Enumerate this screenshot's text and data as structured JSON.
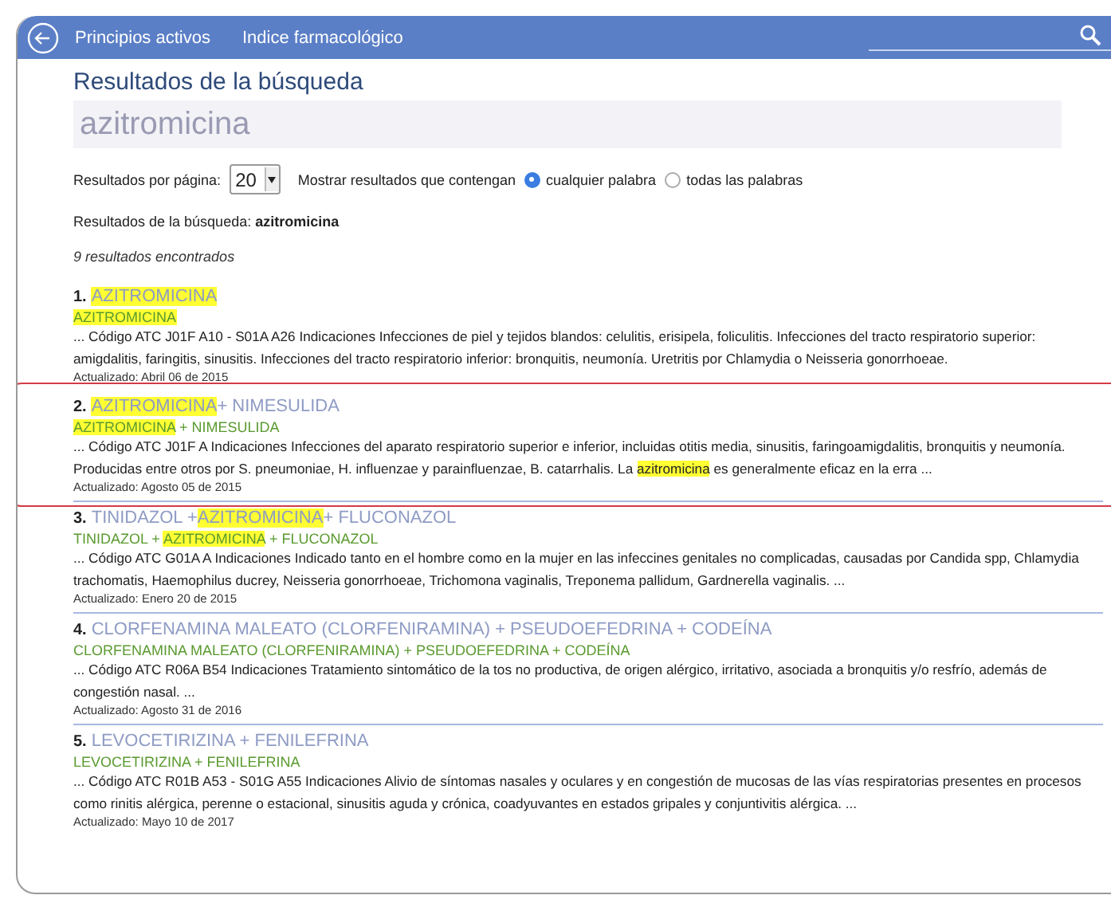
{
  "nav": {
    "links": [
      "Principios activos",
      "Indice farmacológico"
    ]
  },
  "heading": "Resultados de la búsqueda",
  "search": {
    "value": "azitromicina"
  },
  "options": {
    "per_page_label": "Resultados por página:",
    "per_page": "20",
    "contain_label": "Mostrar resultados que contengan",
    "radios": [
      {
        "label": "cualquier palabra",
        "selected": true
      },
      {
        "label": "todas las palabras",
        "selected": false
      }
    ]
  },
  "summary": "Resultados de la búsqueda: **azitromicina**",
  "count": "9 resultados encontrados",
  "results": [
    {
      "number": "1.",
      "circled": false,
      "title": [
        {
          "text": "AZITROMICINA",
          "highlight": true
        }
      ],
      "subtitle": [
        {
          "text": "AZITROMICINA",
          "highlight": true
        }
      ],
      "body": [
        {
          "text": "... Código ATC J01F A10 - S01A A26 Indicaciones Infecciones de piel y tejidos blandos: celulitis, erisipela, foliculitis. Infecciones del tracto respiratorio superior: amigdalitis, faringitis, sinusitis. Infecciones del tracto respiratorio inferior: bronquitis, neumonía. Uretritis por Chlamydia o Neisseria gonorrhoeae.",
          "highlight": false
        }
      ],
      "updated": "Actualizado: Abril 06 de 2015"
    },
    {
      "number": "2.",
      "circled": true,
      "title": [
        {
          "text": "AZITROMICINA",
          "highlight": true
        },
        {
          "text": " + NIMESULIDA",
          "highlight": false
        }
      ],
      "subtitle": [
        {
          "text": "AZITROMICINA",
          "highlight": true
        },
        {
          "text": " + NIMESULIDA",
          "highlight": false
        }
      ],
      "body": [
        {
          "text": "... Código ATC J01F A Indicaciones Infecciones del aparato respiratorio superior e inferior, incluidas otitis media, sinusitis, faringoamigdalitis, bronquitis y neumonía. Producidas entre otros por S. pneumoniae, H. influenzae y parainfluenzae, B. catarrhalis. La ",
          "highlight": false
        },
        {
          "text": "azitromicina",
          "highlight": true
        },
        {
          "text": " es generalmente eficaz en la erra ...",
          "highlight": false
        }
      ],
      "updated": "Actualizado: Agosto 05 de 2015"
    },
    {
      "number": "3.",
      "circled": false,
      "title": [
        {
          "text": "TINIDAZOL + ",
          "highlight": false
        },
        {
          "text": "AZITROMICINA",
          "highlight": true
        },
        {
          "text": " + FLUCONAZOL",
          "highlight": false
        }
      ],
      "subtitle": [
        {
          "text": "TINIDAZOL + ",
          "highlight": false
        },
        {
          "text": "AZITROMICINA",
          "highlight": true
        },
        {
          "text": " + FLUCONAZOL",
          "highlight": false
        }
      ],
      "body": [
        {
          "text": "... Código ATC G01A A Indicaciones Indicado tanto en el hombre como en la mujer en las infeccines genitales no complicadas, causadas por Candida spp, Chlamydia trachomatis, Haemophilus ducrey, Neisseria gonorrhoeae, Trichomona vaginalis, Treponema pallidum, Gardnerella vaginalis. ...",
          "highlight": false
        }
      ],
      "updated": "Actualizado: Enero 20 de 2015"
    },
    {
      "number": "4.",
      "circled": false,
      "title": [
        {
          "text": "CLORFENAMINA MALEATO (CLORFENIRAMINA) + PSEUDOEFEDRINA + CODEÍNA",
          "highlight": false
        }
      ],
      "subtitle": [
        {
          "text": "CLORFENAMINA MALEATO (CLORFENIRAMINA) + PSEUDOEFEDRINA + CODEÍNA",
          "highlight": false
        }
      ],
      "body": [
        {
          "text": "... Código ATC R06A B54 Indicaciones Tratamiento sintomático de la tos no productiva, de origen alérgico, irritativo, asociada a bronquitis y/o resfrío, además de congestión nasal. ...",
          "highlight": false
        }
      ],
      "updated": "Actualizado: Agosto 31 de 2016"
    },
    {
      "number": "5.",
      "circled": false,
      "title": [
        {
          "text": "LEVOCETIRIZINA + FENILEFRINA",
          "highlight": false
        }
      ],
      "subtitle": [
        {
          "text": "LEVOCETIRIZINA + FENILEFRINA",
          "highlight": false
        }
      ],
      "body": [
        {
          "text": "... Código ATC R01B A53 - S01G A55 Indicaciones Alivio de síntomas nasales y oculares y en congestión de mucosas de las vías respiratorias presentes en procesos como rinitis alérgica, perenne o estacional, sinusitis aguda y crónica, coadyuvantes en estados gripales y conjuntivitis alérgica. ...",
          "highlight": false
        }
      ],
      "updated": "Actualizado: Mayo 10 de 2017"
    }
  ]
}
